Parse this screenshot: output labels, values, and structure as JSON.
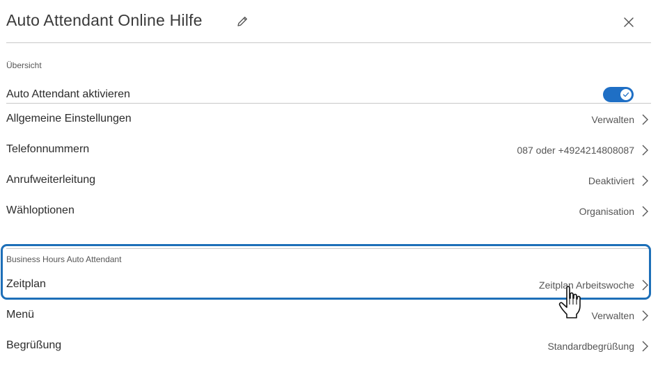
{
  "header": {
    "title": "Auto Attendant Online Hilfe"
  },
  "overview": {
    "section_label": "Übersicht",
    "toggle_label": "Auto Attendant aktivieren",
    "toggle_state": "on",
    "rows": [
      {
        "label": "Allgemeine Einstellungen",
        "value": "Verwalten"
      },
      {
        "label": "Telefonnummern",
        "value": "087 oder +4924214808087"
      },
      {
        "label": "Anrufweiterleitung",
        "value": "Deaktiviert"
      },
      {
        "label": "Wähloptionen",
        "value": "Organisation"
      }
    ]
  },
  "business_hours": {
    "section_label": "Business Hours Auto Attendant",
    "rows": [
      {
        "label": "Zeitplan",
        "value": "Zeitplan Arbeitswoche"
      },
      {
        "label": "Menü",
        "value": "Verwalten"
      },
      {
        "label": "Begrüßung",
        "value": "Standardbegrüßung"
      }
    ]
  },
  "colors": {
    "accent": "#1f6fc5",
    "highlight_border": "#1d6fb8",
    "divider": "#c8c8c8"
  },
  "icons": [
    "edit-icon",
    "close-icon",
    "chevron-right-icon",
    "check-icon",
    "hand-pointer-icon"
  ]
}
